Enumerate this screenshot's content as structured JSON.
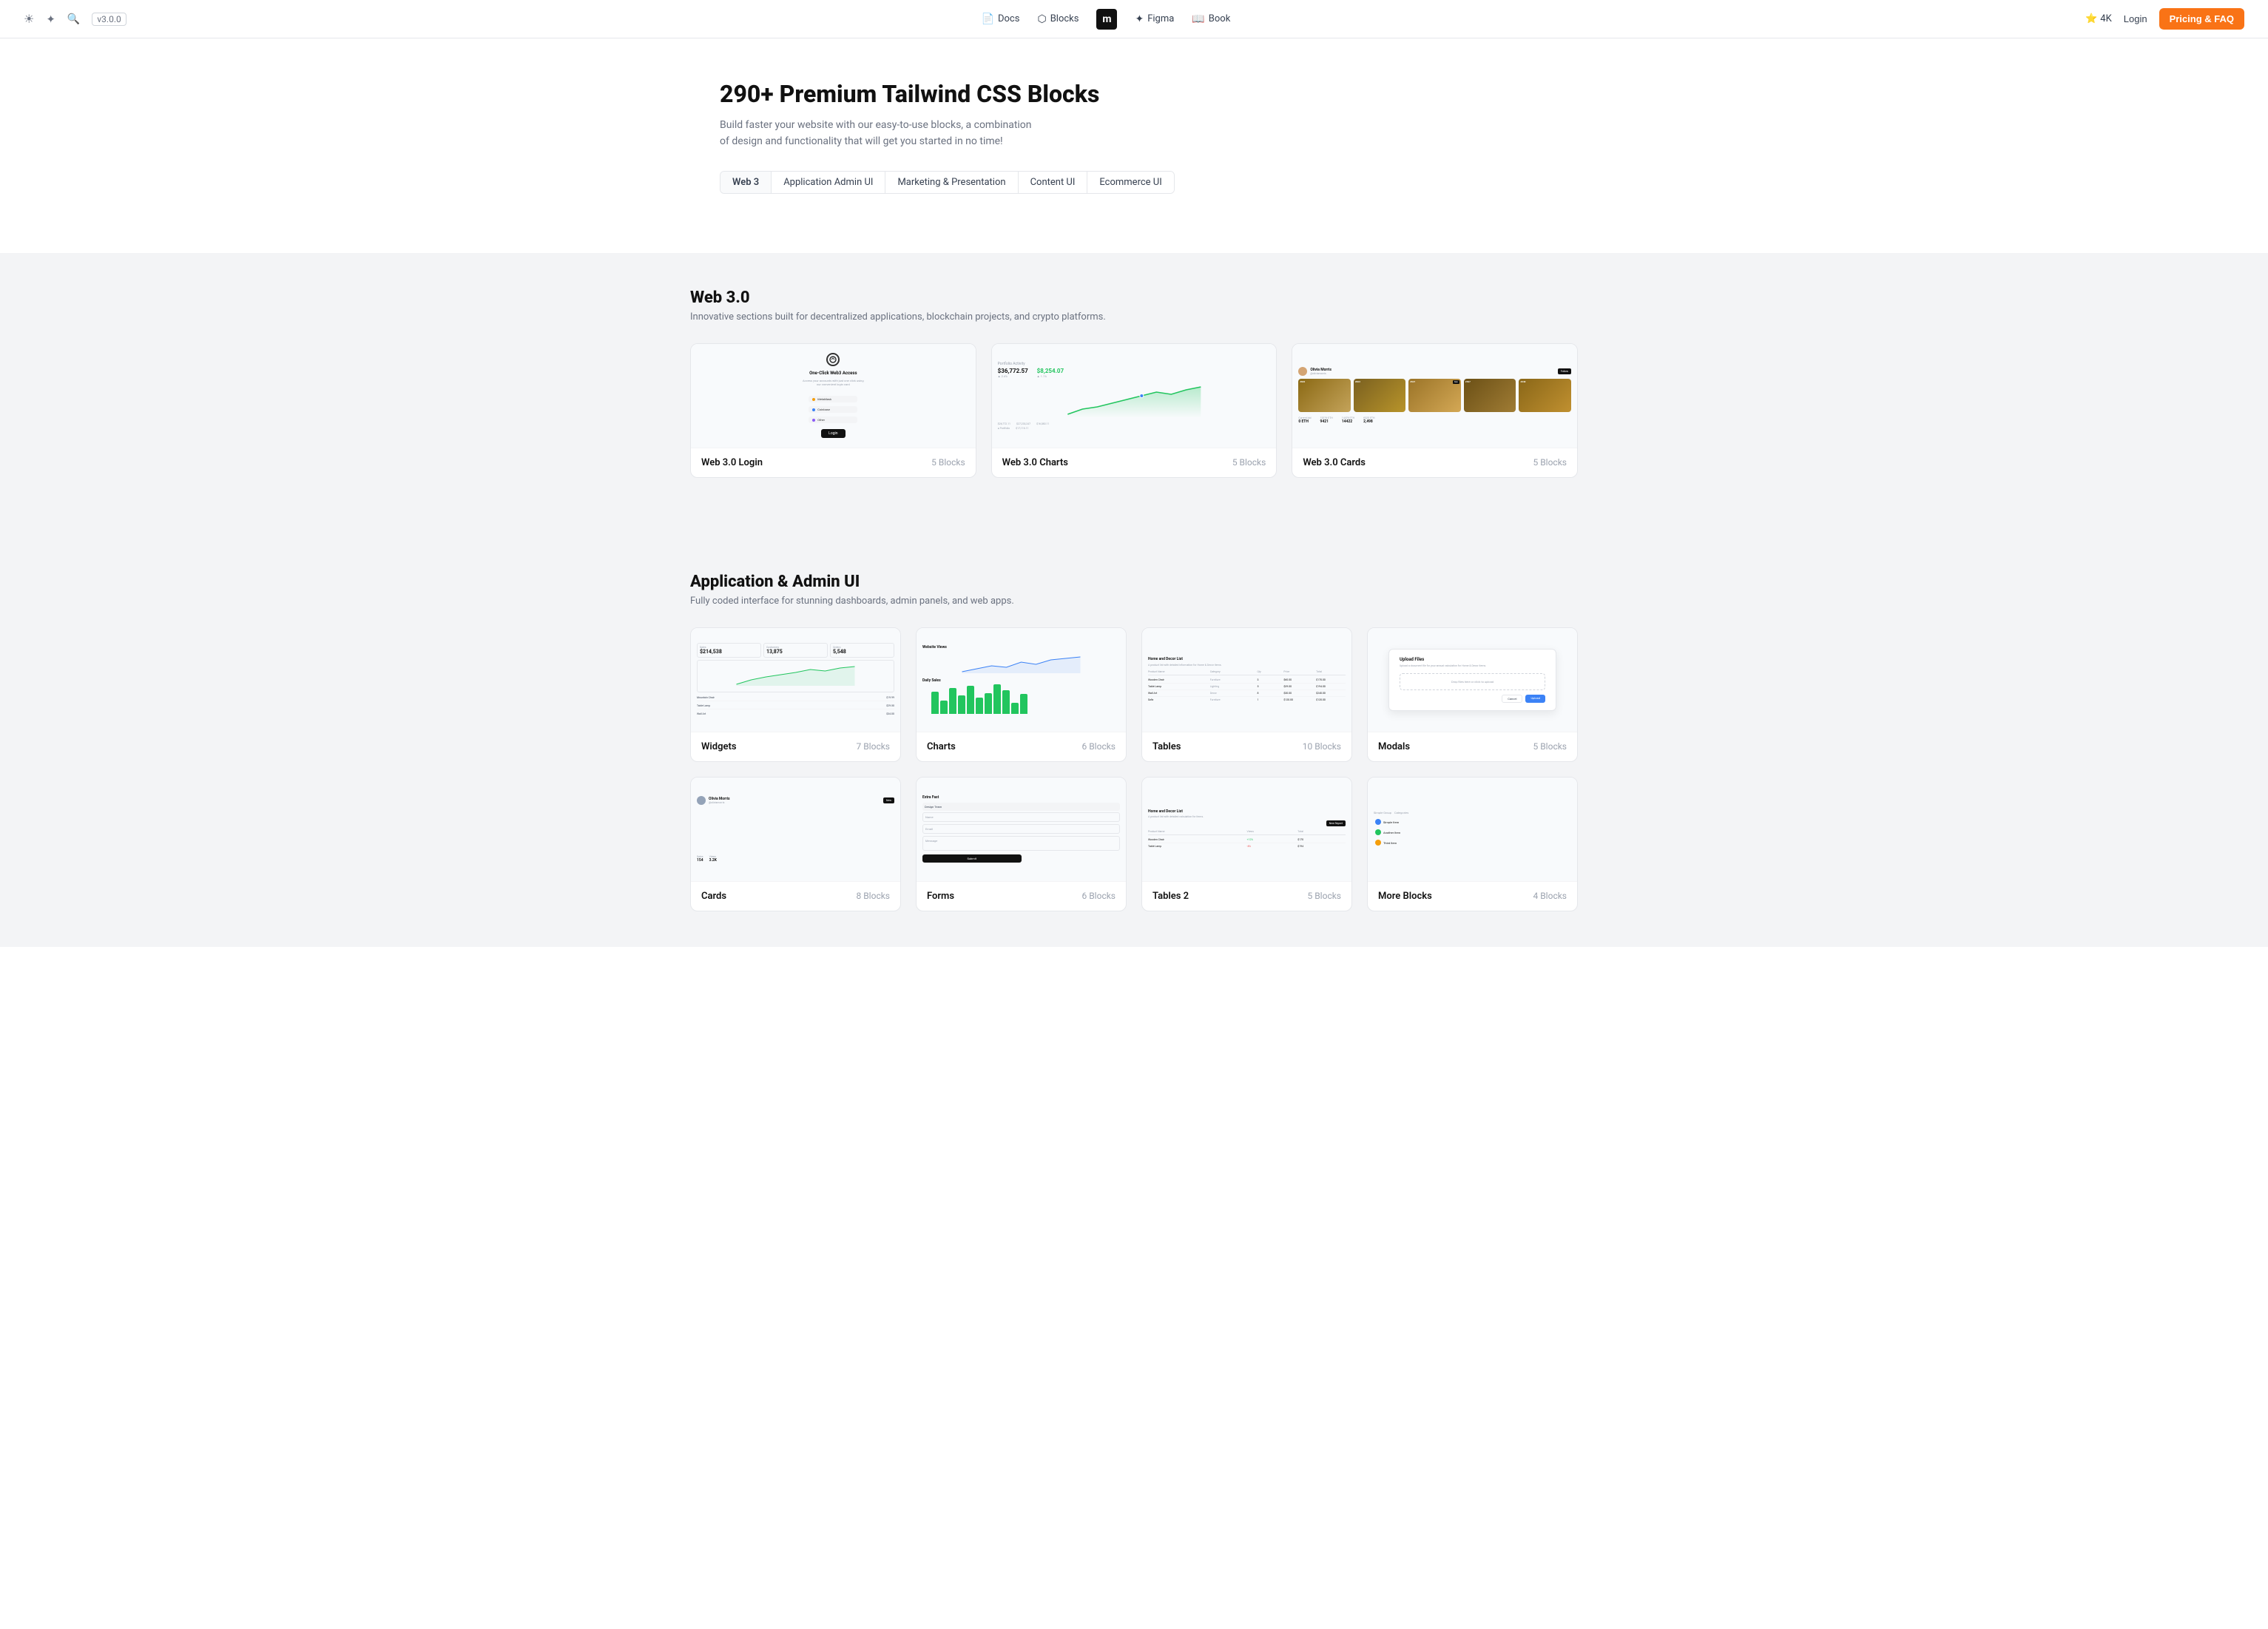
{
  "navbar": {
    "logo_label": "m",
    "version": "v3.0.0",
    "docs_label": "Docs",
    "blocks_label": "Blocks",
    "figma_label": "Figma",
    "book_label": "Book",
    "star_label": "4K",
    "login_label": "Login",
    "cta_label": "Pricing & FAQ"
  },
  "hero": {
    "title": "290+ Premium Tailwind CSS Blocks",
    "desc_line1": "Build faster your website with our easy-to-use blocks, a combination",
    "desc_line2": "of design and functionality that will get you started in no time!",
    "filters": [
      "Web 3",
      "Application Admin UI",
      "Marketing & Presentation",
      "Content UI",
      "Ecommerce UI"
    ]
  },
  "sections": [
    {
      "id": "web3",
      "title": "Web 3.0",
      "desc": "Innovative sections built for decentralized applications, blockchain projects, and crypto platforms.",
      "cards": [
        {
          "title": "Web 3.0 Login",
          "blocks": "5 Blocks",
          "type": "web3-login"
        },
        {
          "title": "Web 3.0 Charts",
          "blocks": "5 Blocks",
          "type": "web3-charts"
        },
        {
          "title": "Web 3.0 Cards",
          "blocks": "5 Blocks",
          "type": "web3-cards"
        }
      ],
      "grid": "3"
    },
    {
      "id": "admin",
      "title": "Application & Admin UI",
      "desc": "Fully coded interface for stunning dashboards, admin panels, and web apps.",
      "cards": [
        {
          "title": "Widgets",
          "blocks": "7 Blocks",
          "type": "admin-widgets"
        },
        {
          "title": "Charts",
          "blocks": "6 Blocks",
          "type": "admin-charts"
        },
        {
          "title": "Tables",
          "blocks": "10 Blocks",
          "type": "admin-tables"
        },
        {
          "title": "Modals",
          "blocks": "5 Blocks",
          "type": "admin-modals"
        },
        {
          "title": "Cards",
          "blocks": "8 Blocks",
          "type": "admin-cards2"
        },
        {
          "title": "Forms",
          "blocks": "6 Blocks",
          "type": "admin-forms"
        },
        {
          "title": "Tables 2",
          "blocks": "5 Blocks",
          "type": "admin-tables2"
        },
        {
          "title": "More Blocks",
          "blocks": "4 Blocks",
          "type": "admin-more"
        }
      ],
      "grid": "4"
    }
  ]
}
